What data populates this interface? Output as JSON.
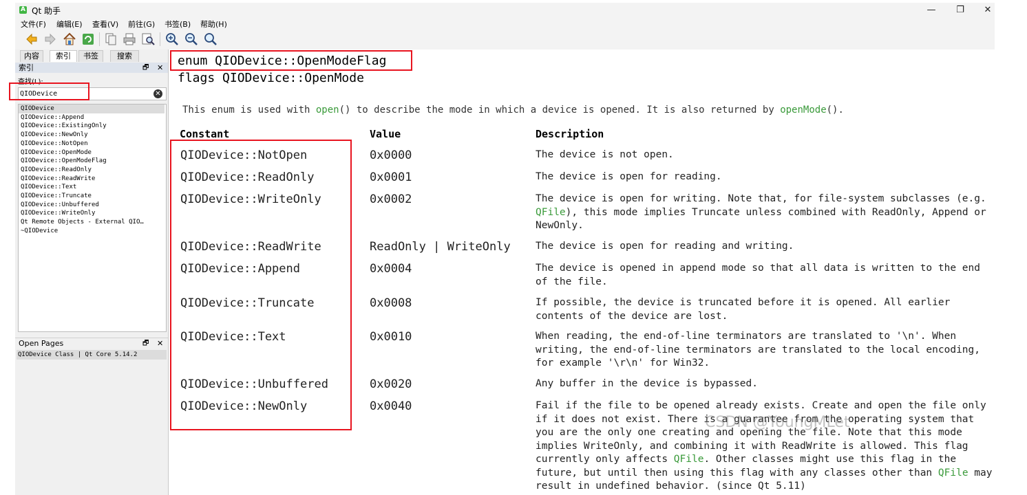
{
  "window": {
    "icon_label": "A",
    "title": "Qt 助手",
    "minimize_glyph": "—",
    "maximize_glyph": "❐",
    "close_glyph": "✕"
  },
  "menu": [
    "文件(F)",
    "编辑(E)",
    "查看(V)",
    "前往(G)",
    "书签(B)",
    "帮助(H)"
  ],
  "toolbar_icons": [
    "back-arrow-icon",
    "forward-arrow-icon",
    "home-icon",
    "sync-icon",
    "copy-icon",
    "print-icon",
    "find-icon",
    "zoom-in-icon",
    "zoom-out-icon",
    "zoom-reset-icon"
  ],
  "left_panel": {
    "tabs": [
      "内容",
      "索引",
      "书签",
      "搜索"
    ],
    "active_tab": "索引",
    "index_dock_title": "索引",
    "float_glyph": "🗗",
    "close_glyph": "✕",
    "find_label": "查找(L):",
    "search_value": "QIODevice",
    "clear_glyph": "✕",
    "index_items": [
      "QIODevice",
      "QIODevice::Append",
      "QIODevice::ExistingOnly",
      "QIODevice::NewOnly",
      "QIODevice::NotOpen",
      "QIODevice::OpenMode",
      "QIODevice::OpenModeFlag",
      "QIODevice::ReadOnly",
      "QIODevice::ReadWrite",
      "QIODevice::Text",
      "QIODevice::Truncate",
      "QIODevice::Unbuffered",
      "QIODevice::WriteOnly",
      "Qt Remote Objects - External QIO…",
      "~QIODevice"
    ],
    "open_pages_title": "Open Pages",
    "open_pages": [
      "QIODevice Class | Qt Core 5.14.2"
    ]
  },
  "content": {
    "heading1": "enum QIODevice::OpenModeFlag",
    "heading2": "flags QIODevice::OpenMode",
    "intro": {
      "p1": "This enum is used with ",
      "link1": "open",
      "p2": "() to describe the mode in which a device is opened. It is also returned by ",
      "link2": "openMode",
      "p3": "()."
    },
    "table_headers": [
      "Constant",
      "Value",
      "Description"
    ],
    "rows": [
      {
        "constant": "QIODevice::NotOpen",
        "value": "0x0000",
        "d1": "The device is not open."
      },
      {
        "constant": "QIODevice::ReadOnly",
        "value": "0x0001",
        "d1": "The device is open for reading."
      },
      {
        "constant": "QIODevice::WriteOnly",
        "value": "0x0002",
        "d1": "The device is open for writing. Note that, for file-system subclasses (e.g. ",
        "link": "QFile",
        "d2": "), this mode implies Truncate unless combined with ReadOnly, Append or NewOnly."
      },
      {
        "constant": "QIODevice::ReadWrite",
        "value": "ReadOnly | WriteOnly",
        "d1": "The device is open for reading and writing."
      },
      {
        "constant": "QIODevice::Append",
        "value": "0x0004",
        "d1": "The device is opened in append mode so that all data is written to the end of the file."
      },
      {
        "constant": "QIODevice::Truncate",
        "value": "0x0008",
        "d1": "If possible, the device is truncated before it is opened. All earlier contents of the device are lost."
      },
      {
        "constant": "QIODevice::Text",
        "value": "0x0010",
        "d1": "When reading, the end-of-line terminators are translated to '\\n'. When writing, the end-of-line terminators are translated to the local encoding, for example '\\r\\n' for Win32."
      },
      {
        "constant": "QIODevice::Unbuffered",
        "value": "0x0020",
        "d1": "Any buffer in the device is bypassed."
      },
      {
        "constant": "QIODevice::NewOnly",
        "value": "0x0040",
        "d1": "Fail if the file to be opened already exists. Create and open the file only if it does not exist. There is a guarantee from the operating system that you are the only one creating and opening the file. Note that this mode implies WriteOnly, and combining it with ReadWrite is allowed. This flag currently only affects ",
        "link": "QFile",
        "d2": ". Other classes might use this flag in the future, but until then using this flag with any classes other than ",
        "link2": "QFile",
        "d3": " may result in undefined behavior. (since Qt 5.11)"
      }
    ]
  },
  "watermark": "CSDN @YoungMLet",
  "colors": {
    "link": "#3a9a3a",
    "annotation_red": "#e8141f",
    "selection": "#dcdcdc",
    "dock_title": "#dde3ec"
  }
}
